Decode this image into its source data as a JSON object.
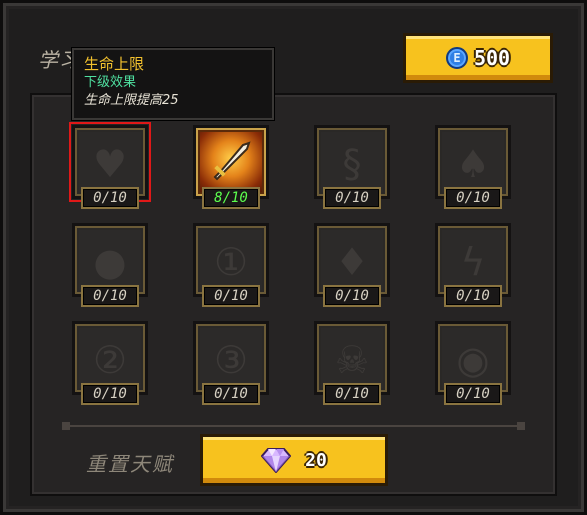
{
  "panel": {
    "title": "学习天赋点"
  },
  "currency": {
    "coin_icon_letter": "E",
    "coin_value": "500",
    "gem_value": "20"
  },
  "tooltip": {
    "title": "生命上限",
    "subtitle": "下级效果",
    "description": "生命上限提高25"
  },
  "skills": [
    {
      "name": "max-health",
      "icon": "heart-icon",
      "count": "0/10",
      "state": "selected"
    },
    {
      "name": "weapon",
      "icon": "sword-icon",
      "count": "8/10",
      "state": "active"
    },
    {
      "name": "talent-3",
      "icon": "spiral-icon",
      "count": "0/10",
      "state": "locked"
    },
    {
      "name": "talent-4",
      "icon": "flame-icon",
      "count": "0/10",
      "state": "locked"
    },
    {
      "name": "talent-5",
      "icon": "blob-icon",
      "count": "0/10",
      "state": "locked"
    },
    {
      "name": "talent-6",
      "icon": "medal-1-icon",
      "count": "0/10",
      "state": "locked"
    },
    {
      "name": "talent-7",
      "icon": "shield-drop-icon",
      "count": "0/10",
      "state": "locked"
    },
    {
      "name": "talent-8",
      "icon": "lightning-icon",
      "count": "0/10",
      "state": "locked"
    },
    {
      "name": "talent-9",
      "icon": "medal-2-icon",
      "count": "0/10",
      "state": "locked"
    },
    {
      "name": "talent-10",
      "icon": "medal-3-icon",
      "count": "0/10",
      "state": "locked"
    },
    {
      "name": "talent-11",
      "icon": "skull-icon",
      "count": "0/10",
      "state": "locked"
    },
    {
      "name": "talent-12",
      "icon": "eye-icon",
      "count": "0/10",
      "state": "locked"
    }
  ],
  "reset": {
    "label": "重置天赋"
  },
  "colors": {
    "button_yellow": "#f7c21e",
    "selected_outline": "#e01818",
    "active_count": "#5cff4e",
    "tooltip_title": "#f2c12e",
    "tooltip_subtitle": "#4fe0a0"
  }
}
